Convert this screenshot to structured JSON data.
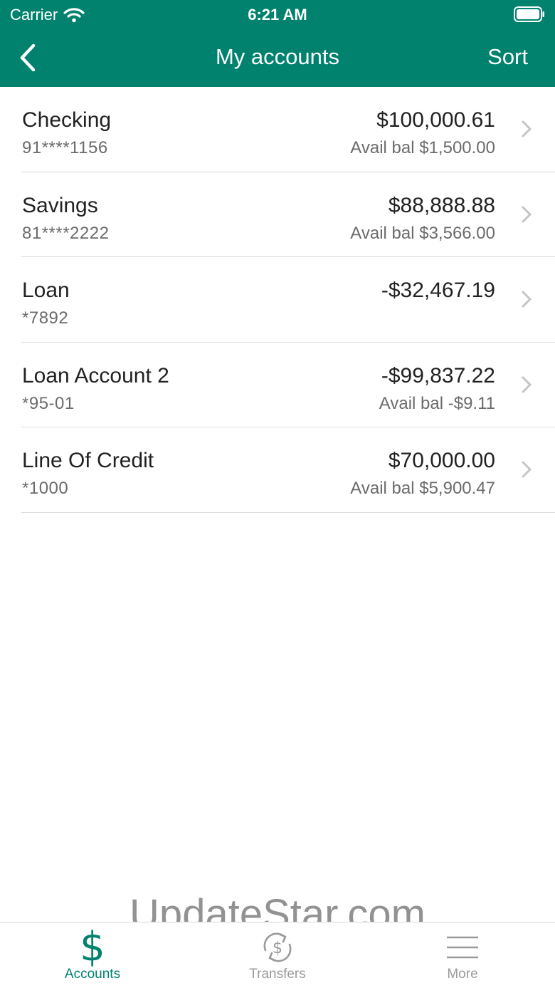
{
  "status": {
    "carrier": "Carrier",
    "time": "6:21 AM"
  },
  "nav": {
    "title": "My accounts",
    "sort_label": "Sort"
  },
  "accounts": [
    {
      "name": "Checking",
      "number": "91****1156",
      "balance": "$100,000.61",
      "avail": "Avail bal $1,500.00"
    },
    {
      "name": "Savings",
      "number": "81****2222",
      "balance": "$88,888.88",
      "avail": "Avail bal $3,566.00"
    },
    {
      "name": "Loan",
      "number": "*7892",
      "balance": "-$32,467.19",
      "avail": ""
    },
    {
      "name": "Loan Account 2",
      "number": "*95-01",
      "balance": "-$99,837.22",
      "avail": "Avail bal -$9.11"
    },
    {
      "name": "Line Of Credit",
      "number": "*1000",
      "balance": "$70,000.00",
      "avail": "Avail bal $5,900.47"
    }
  ],
  "watermark": "UpdateStar.com",
  "tabs": {
    "accounts": {
      "label": "Accounts",
      "icon": "dollar-icon"
    },
    "transfers": {
      "label": "Transfers",
      "icon": "transfer-dollar-icon"
    },
    "more": {
      "label": "More",
      "icon": "hamburger-menu-icon"
    }
  },
  "colors": {
    "brand": "#00826f",
    "inactive": "#9a9a9a",
    "divider": "#dcdcdc"
  }
}
